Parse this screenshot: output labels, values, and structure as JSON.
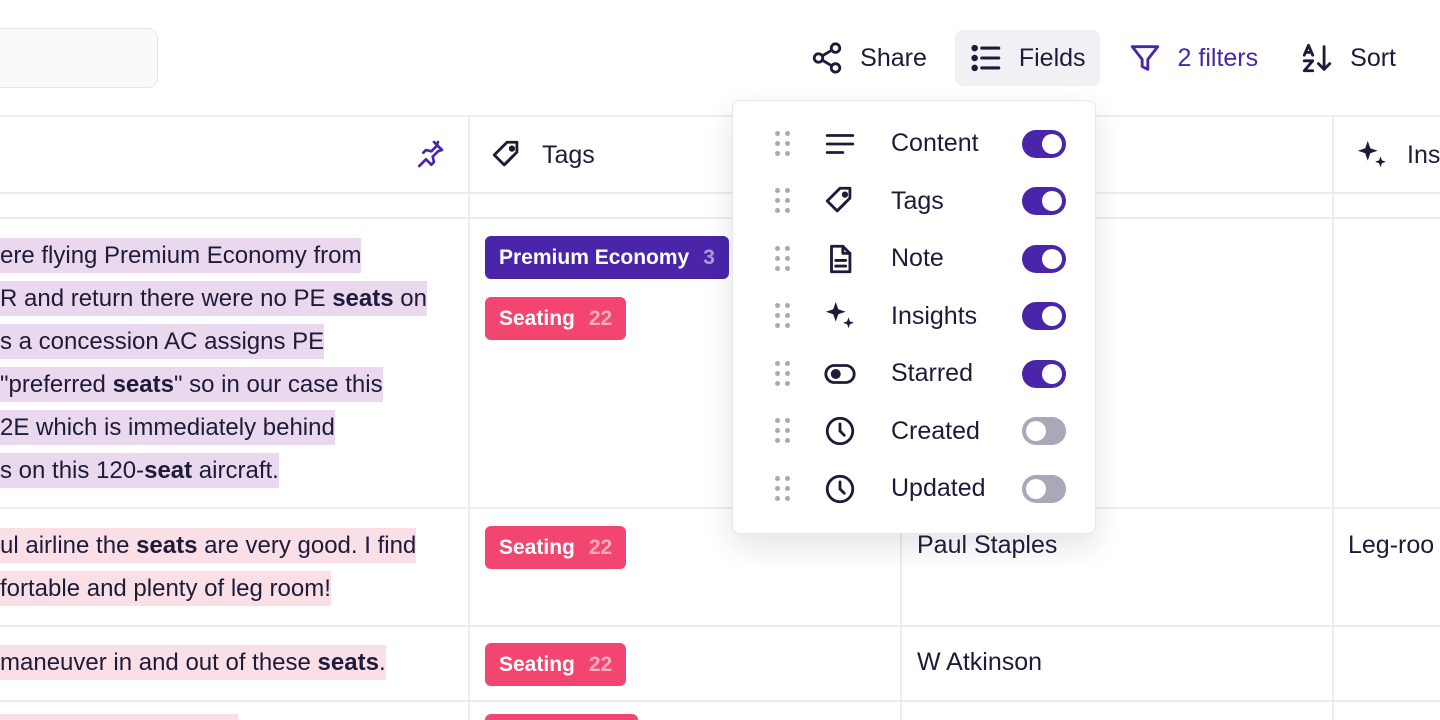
{
  "toolbar": {
    "share_label": "Share",
    "fields_label": "Fields",
    "filters_label": "2 filters",
    "sort_label": "Sort",
    "accent_color": "#4a25aa"
  },
  "columns": {
    "tags": "Tags",
    "insights": "Ins"
  },
  "rows": [
    {
      "content_lines": [
        [
          "ere flying Premium Economy from",
          ""
        ],
        [
          "R and return there were no PE ",
          "seats",
          " on"
        ],
        [
          "s a concession AC assigns PE",
          ""
        ],
        [
          " \"preferred ",
          "seats",
          "\" so in our case this"
        ],
        [
          "2E which is immediately behind",
          ""
        ],
        [
          "s on this 120-",
          "seat",
          " aircraft."
        ]
      ],
      "tags": [
        {
          "label": "Premium Economy",
          "count": "3",
          "color": "#4a25aa"
        },
        {
          "label": "Seating",
          "count": "22",
          "color": "#f2456f"
        }
      ]
    },
    {
      "content_lines": [
        [
          "ul airline the ",
          "seats",
          " are very good. I find"
        ],
        [
          "fortable and plenty of leg room!",
          ""
        ]
      ],
      "tags": [
        {
          "label": "Seating",
          "count": "22",
          "color": "#f2456f"
        }
      ],
      "name": "Paul Staples",
      "insight": "Leg-roo"
    },
    {
      "content_lines": [
        [
          " maneuver in and out of these ",
          "seats",
          "."
        ]
      ],
      "tags": [
        {
          "label": "Seating",
          "count": "22",
          "color": "#f2456f"
        }
      ],
      "name": "W Atkinson"
    }
  ],
  "fields_menu": {
    "items": [
      {
        "label": "Content",
        "icon": "lines-icon",
        "enabled": true
      },
      {
        "label": "Tags",
        "icon": "tag-icon",
        "enabled": true
      },
      {
        "label": "Note",
        "icon": "document-icon",
        "enabled": true
      },
      {
        "label": "Insights",
        "icon": "sparkles-icon",
        "enabled": true
      },
      {
        "label": "Starred",
        "icon": "toggle-pill-icon",
        "enabled": true
      },
      {
        "label": "Created",
        "icon": "clock-icon",
        "enabled": false
      },
      {
        "label": "Updated",
        "icon": "clock-icon",
        "enabled": false
      }
    ]
  }
}
